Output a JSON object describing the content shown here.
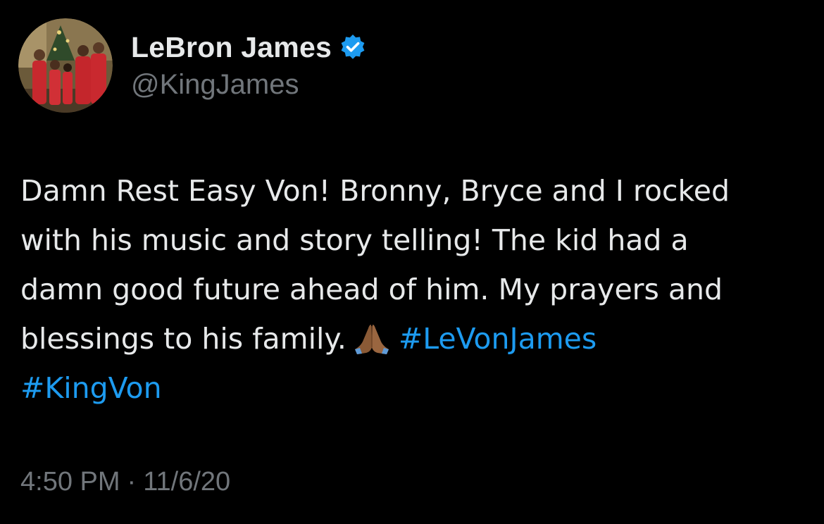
{
  "author": {
    "display_name": "LeBron James",
    "handle": "@KingJames",
    "verified": true,
    "avatar_icon": "family-photo-avatar"
  },
  "tweet": {
    "lines": [
      "Damn Rest Easy Von! Bronny, Bryce and I rocked",
      "with his music and story telling! The kid had a",
      "damn good future ahead of him. My prayers and",
      "blessings to his family."
    ],
    "emoji": "praying-hands-icon",
    "hashtags": [
      "#LeVonJames",
      "#KingVon"
    ]
  },
  "meta": {
    "time": "4:50 PM",
    "separator": "·",
    "date": "11/6/20"
  },
  "colors": {
    "background": "#000000",
    "text": "#e7e9ea",
    "secondary": "#71767b",
    "link": "#1d9bf0",
    "verified": "#1d9bf0"
  }
}
